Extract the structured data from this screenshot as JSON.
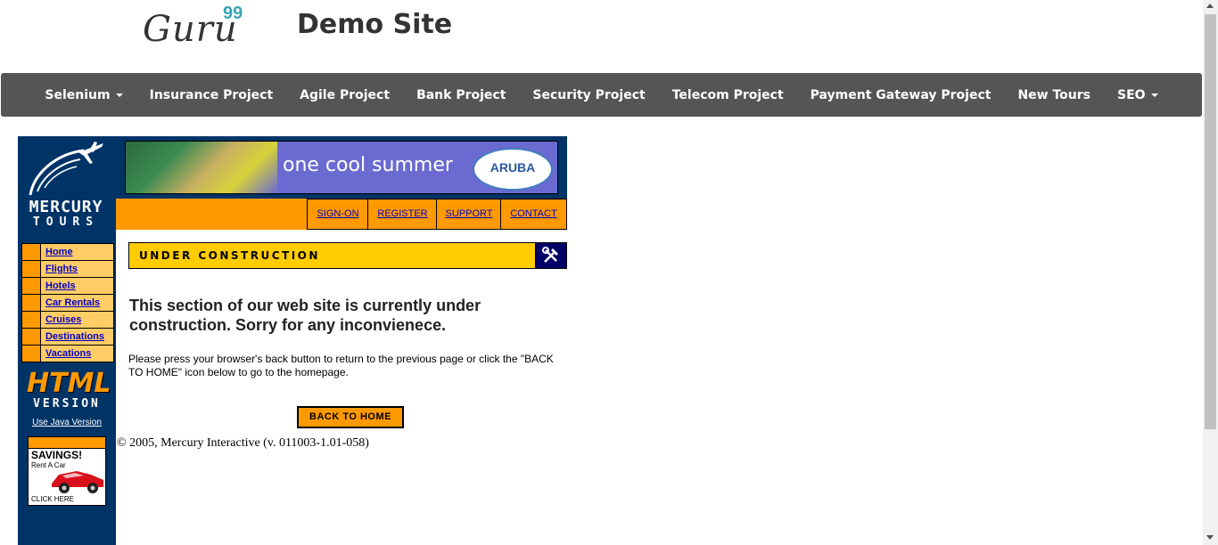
{
  "header": {
    "logo_text": "Guru",
    "logo_sup": "99",
    "site_title": "Demo Site"
  },
  "navbar": {
    "items": [
      {
        "label": "Selenium",
        "dropdown": true
      },
      {
        "label": "Insurance Project",
        "dropdown": false
      },
      {
        "label": "Agile Project",
        "dropdown": false
      },
      {
        "label": "Bank Project",
        "dropdown": false
      },
      {
        "label": "Security Project",
        "dropdown": false
      },
      {
        "label": "Telecom Project",
        "dropdown": false
      },
      {
        "label": "Payment Gateway Project",
        "dropdown": false
      },
      {
        "label": "New Tours",
        "dropdown": false
      },
      {
        "label": "SEO",
        "dropdown": true
      }
    ]
  },
  "mercury": {
    "logo_line1": "MERCURY",
    "logo_line2": "TOURS",
    "banner_text": "one cool summer",
    "banner_brand": "ARUBA",
    "top_links": [
      "SIGN-ON",
      "REGISTER",
      "SUPPORT",
      "CONTACT"
    ],
    "side_links": [
      "Home",
      "Flights",
      "Hotels",
      "Car Rentals",
      "Cruises",
      "Destinations",
      "Vacations"
    ],
    "html_badge_big": "HTML",
    "html_badge_small": "VERSION",
    "java_link": "Use Java Version",
    "savings_title": "SAVINGS!",
    "savings_sub": "Rent A Car",
    "savings_click": "CLICK HERE",
    "uc_title": "UNDER CONSTRUCTION",
    "uc_heading": "This section of our web site is currently under construction.   Sorry for any inconvienece.",
    "uc_para": "Please press your browser's back button to return to the previous page or click the \"BACK TO HOME\" icon below to go to the homepage.",
    "back_button": "BACK TO HOME",
    "copyright": "© 2005, Mercury Interactive (v. 011003-1.01-058)"
  },
  "colors": {
    "navbar_bg": "#555555",
    "sidebar_bg": "#003366",
    "accent_orange": "#ff9900",
    "uc_yellow": "#ffcc00",
    "link_blue": "#0000cc"
  },
  "icons": [
    "plane-logo-icon",
    "caret-down-icon",
    "tools-icon",
    "car-icon"
  ]
}
